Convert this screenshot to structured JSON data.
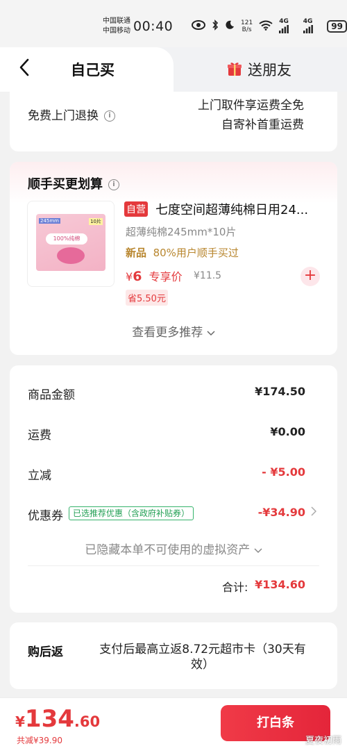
{
  "status_bar": {
    "carrier1": "中国联通",
    "carrier2": "中国移动",
    "time": "00:40",
    "net_speed_value": "121",
    "net_speed_unit": "B/s",
    "sig1": "4G",
    "sig2": "4G",
    "battery": "99"
  },
  "tabs": {
    "self_buy": "自己买",
    "gift_friend": "送朋友"
  },
  "return_section": {
    "label": "免费上门退换",
    "note_line1": "上门取件享运费全免",
    "note_line2": "自寄补首重运费"
  },
  "recommend": {
    "title": "顺手买更划算",
    "product": {
      "badge": "自营",
      "name": "七度空间超薄纯棉日用24...",
      "spec": "超薄纯棉245mm*10片",
      "new_tag": "新品",
      "buy_rate": "80%用户顺手买过",
      "price_symbol": "¥",
      "price": "6",
      "price_label": "专享价",
      "original_price": "¥11.5",
      "saving": "省5.50元",
      "pack_size": "245mm",
      "pack_count": "10片",
      "pack_text": "100%纯棉"
    },
    "more": "查看更多推荐"
  },
  "summary": {
    "goods_label": "商品金额",
    "goods_value": "¥174.50",
    "shipping_label": "运费",
    "shipping_value": "¥0.00",
    "discount_label": "立减",
    "discount_value": "- ¥5.00",
    "coupon_label": "优惠券",
    "coupon_tag": "已选推荐优惠（含政府补贴券）",
    "coupon_value": "-¥34.90",
    "hidden_note": "已隐藏本单不可使用的虚拟资产",
    "total_label": "合计:",
    "total_value": "¥134.60"
  },
  "cashback": {
    "label": "购后返",
    "text": "支付后最高立返8.72元超市卡（30天有效）"
  },
  "bottom": {
    "currency": "¥",
    "price_int": "134",
    "price_dec": ".60",
    "total_discount": "共减¥39.90",
    "pay_button": "打白条",
    "watermark": "夏夜初雨"
  }
}
